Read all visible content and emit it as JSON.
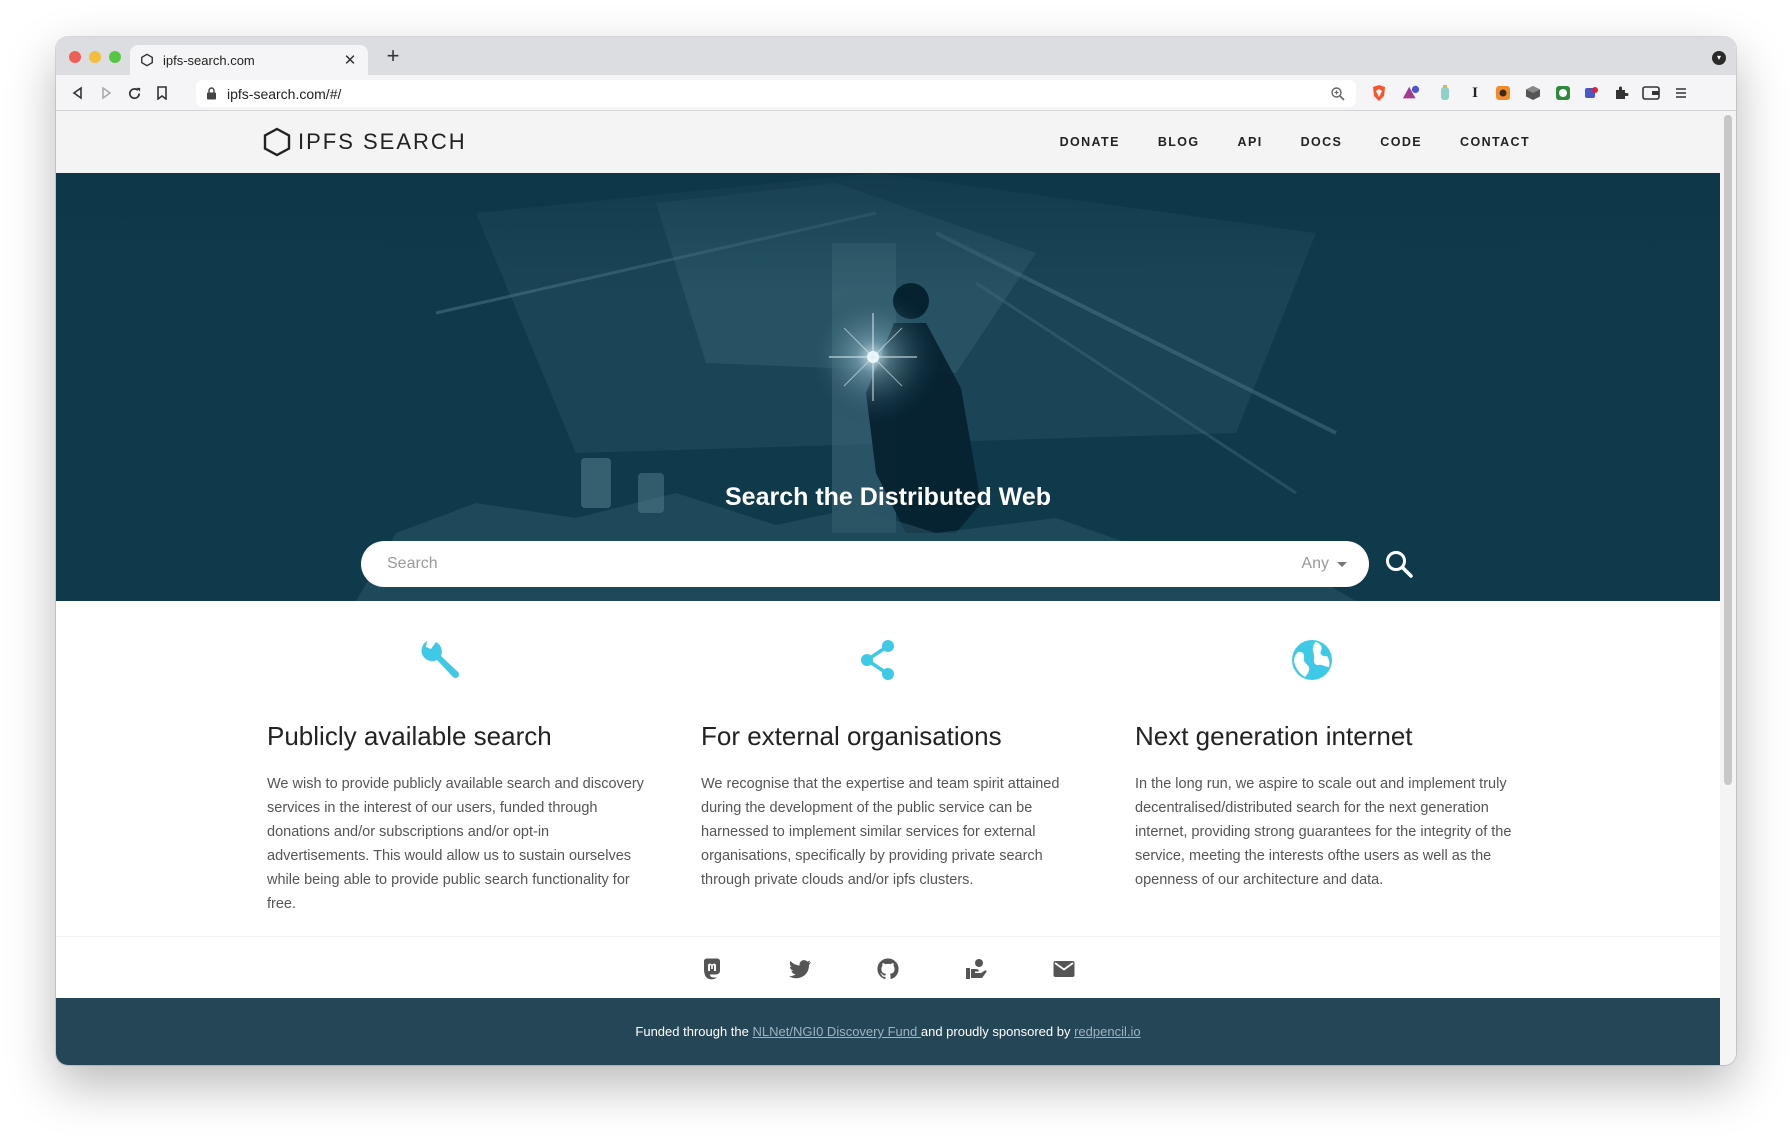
{
  "browser": {
    "tab_title": "ipfs-search.com",
    "url": "ipfs-search.com/#/"
  },
  "site": {
    "logo_text": "IPFS SEARCH",
    "nav": [
      "DONATE",
      "BLOG",
      "API",
      "DOCS",
      "CODE",
      "CONTACT"
    ]
  },
  "hero": {
    "title": "Search the Distributed Web",
    "search_placeholder": "Search",
    "search_type": "Any"
  },
  "features": [
    {
      "icon": "wrench-icon",
      "title": "Publicly available search",
      "text": "We wish to provide publicly available search and discovery services in the interest of our users, funded through donations and/or subscriptions and/or opt-in advertisements. This would allow us to sustain ourselves while being able to provide public search functionality for free."
    },
    {
      "icon": "share-icon",
      "title": "For external organisations",
      "text": "We recognise that the expertise and team spirit attained during the development of the public service can be harnessed to implement similar services for external organisations, specifically by providing private search through private clouds and/or ipfs clusters."
    },
    {
      "icon": "globe-icon",
      "title": "Next generation internet",
      "text": "In the long run, we aspire to scale out and implement truly decentralised/distributed search for the next generation internet, providing strong guarantees for the integrity of the service, meeting the interests ofthe users as well as the openness of our architecture and data."
    }
  ],
  "social": [
    "mastodon-icon",
    "twitter-icon",
    "github-icon",
    "donate-hand-icon",
    "mail-icon"
  ],
  "footer": {
    "prefix": "Funded through the",
    "fund_link": "NLNet/NGI0 Discovery Fund ",
    "middle": "and proudly sponsored by",
    "sponsor_link": "redpencil.io"
  },
  "colors": {
    "hero_bg": "#0f3a4c",
    "accent": "#3ec9e6",
    "footer_bg": "#254657"
  }
}
